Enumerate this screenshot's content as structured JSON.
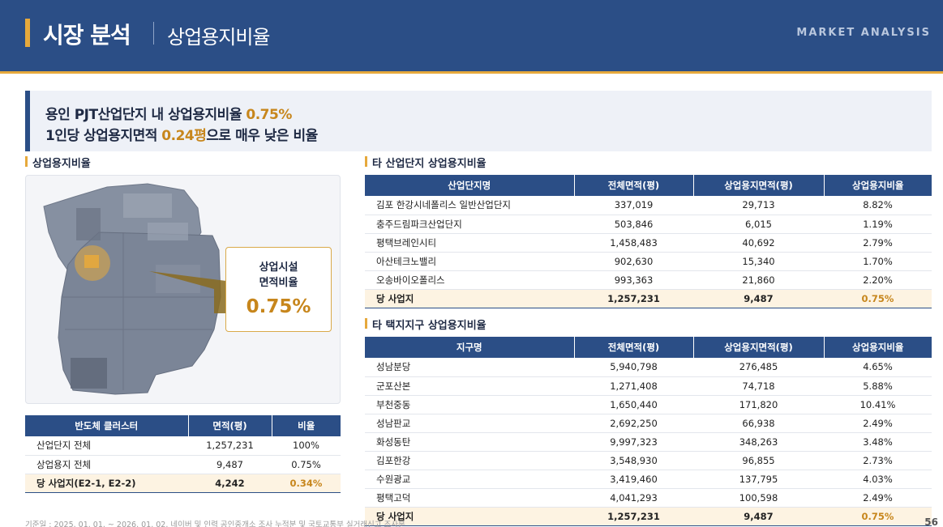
{
  "header": {
    "title": "시장 분석",
    "subtitle": "상업용지비율",
    "tag": "MARKET ANALYSIS"
  },
  "summary": {
    "line1_prefix": "용인 PJT산업단지 내 상업용지비율 ",
    "line1_value": "0.75%",
    "line2_prefix": "1인당 상업용지면적 ",
    "line2_value": "0.24평",
    "line2_suffix": "으로 매우 낮은 비율"
  },
  "left": {
    "section_title": "상업용지비율",
    "callout": {
      "line1": "상업시설",
      "line2": "면적비율",
      "value": "0.75%"
    },
    "table": {
      "headers": [
        "반도체 클러스터",
        "면적(평)",
        "비율"
      ],
      "rows": [
        [
          "산업단지 전체",
          "1,257,231",
          "100%"
        ],
        [
          "상업용지 전체",
          "9,487",
          "0.75%"
        ],
        [
          "당 사업지(E2-1, E2-2)",
          "4,242",
          "0.34%"
        ]
      ]
    }
  },
  "right_top": {
    "section_title": "타 산업단지 상업용지비율",
    "headers": [
      "산업단지명",
      "전체면적(평)",
      "상업용지면적(평)",
      "상업용지비율"
    ],
    "rows": [
      [
        "김포 한강시네폴리스 일반산업단지",
        "337,019",
        "29,713",
        "8.82%"
      ],
      [
        "충주드림파크산업단지",
        "503,846",
        "6,015",
        "1.19%"
      ],
      [
        "평택브레인시티",
        "1,458,483",
        "40,692",
        "2.79%"
      ],
      [
        "아산테크노밸리",
        "902,630",
        "15,340",
        "1.70%"
      ],
      [
        "오송바이오폴리스",
        "993,363",
        "21,860",
        "2.20%"
      ],
      [
        "당 사업지",
        "1,257,231",
        "9,487",
        "0.75%"
      ]
    ]
  },
  "right_bottom": {
    "section_title": "타 택지지구 상업용지비율",
    "headers": [
      "지구명",
      "전체면적(평)",
      "상업용지면적(평)",
      "상업용지비율"
    ],
    "rows": [
      [
        "성남분당",
        "5,940,798",
        "276,485",
        "4.65%"
      ],
      [
        "군포산본",
        "1,271,408",
        "74,718",
        "5.88%"
      ],
      [
        "부천중동",
        "1,650,440",
        "171,820",
        "10.41%"
      ],
      [
        "성남판교",
        "2,692,250",
        "66,938",
        "2.49%"
      ],
      [
        "화성동탄",
        "9,997,323",
        "348,263",
        "3.48%"
      ],
      [
        "김포한강",
        "3,548,930",
        "96,855",
        "2.73%"
      ],
      [
        "수원광교",
        "3,419,460",
        "137,795",
        "4.03%"
      ],
      [
        "평택고덕",
        "4,041,293",
        "100,598",
        "2.49%"
      ],
      [
        "당 사업지",
        "1,257,231",
        "9,487",
        "0.75%"
      ]
    ]
  },
  "footer": {
    "note": "기준일 : 2025. 01. 01. ~ 2026. 01. 02. 네이버 및 인력 공인중개소 조사 누적분 및 국토교통부 실거래신고 조사분",
    "page": "56"
  },
  "colors": {
    "navy": "#2b4e86",
    "accent": "#e6a93c",
    "highlight_text": "#c7861c",
    "highlight_row": "#fdf3e2"
  }
}
